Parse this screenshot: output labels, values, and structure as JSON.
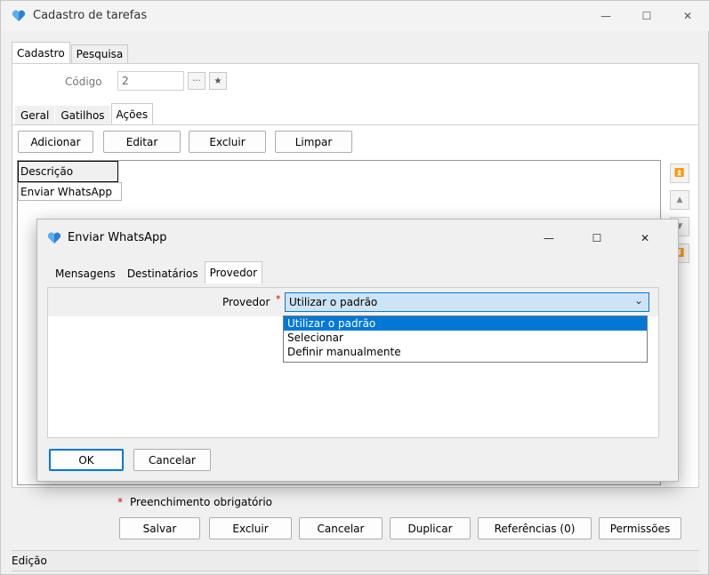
{
  "window": {
    "title": "Cadastro de tarefas",
    "minimize": "—",
    "maximize": "☐",
    "close": "✕"
  },
  "main_tabs": [
    "Cadastro",
    "Pesquisa"
  ],
  "codigo": {
    "label": "Código",
    "value": "2",
    "ellipsis": "···",
    "star": "★"
  },
  "sub_tabs": [
    "Geral",
    "Gatilhos",
    "Ações"
  ],
  "actions_toolbar": {
    "add": "Adicionar",
    "edit": "Editar",
    "delete": "Excluir",
    "clear": "Limpar"
  },
  "actions_table": {
    "header": "Descrição",
    "rows": [
      "Enviar WhatsApp"
    ]
  },
  "side_buttons": [
    "⏫",
    "▲",
    "▼",
    "⏬"
  ],
  "dialog": {
    "title": "Enviar WhatsApp",
    "minimize": "—",
    "maximize": "☐",
    "close": "✕",
    "tabs": [
      "Mensagens",
      "Destinatários",
      "Provedor"
    ],
    "provedor": {
      "label": "Provedor",
      "required": "*",
      "value": "Utilizar o padrão",
      "chevron": "⌄"
    },
    "options": [
      "Utilizar o padrão",
      "Selecionar",
      "Definir manualmente"
    ],
    "ok": "OK",
    "cancel": "Cancelar"
  },
  "footer": {
    "required_mark": "*",
    "required_text": "Preenchimento obrigatório",
    "buttons": [
      "Salvar",
      "Excluir",
      "Cancelar",
      "Duplicar",
      "Referências (0)",
      "Permissões"
    ],
    "status": "Edição"
  },
  "colors": {
    "accent": "#0078d7",
    "required": "#d00000",
    "selected_field": "#cde4f7"
  }
}
